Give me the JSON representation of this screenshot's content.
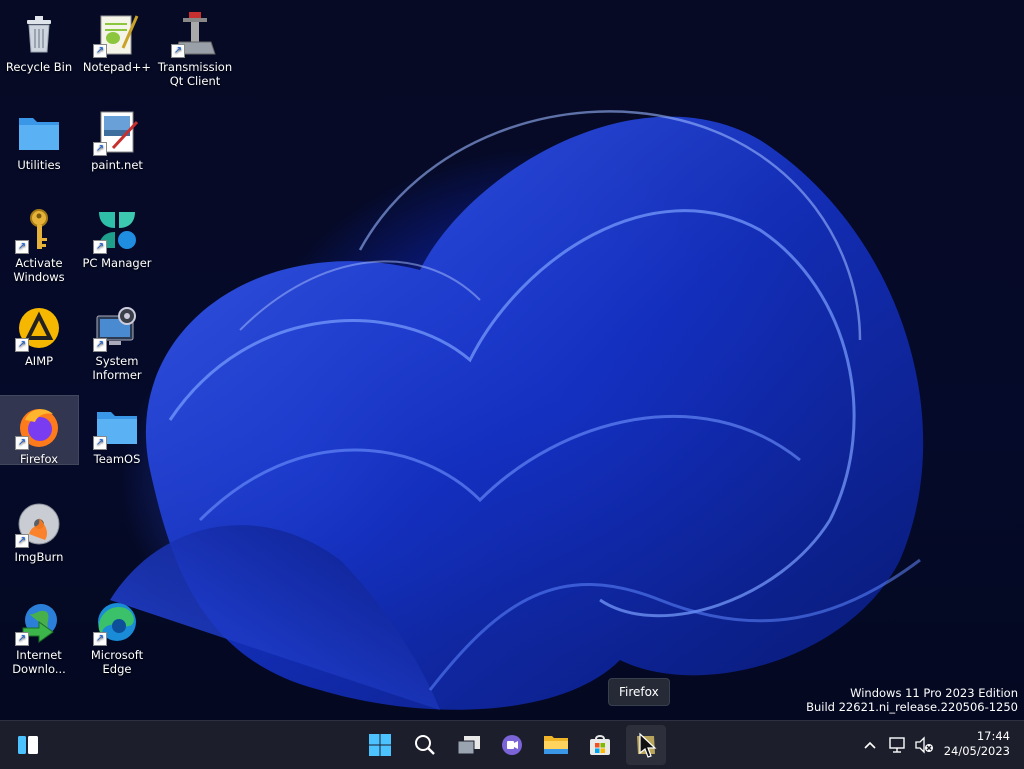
{
  "desktop": {
    "icons": [
      {
        "label": "Recycle Bin"
      },
      {
        "label": "Notepad++"
      },
      {
        "label": "Transmission Qt Client"
      },
      {
        "label": "Utilities"
      },
      {
        "label": "paint.net"
      },
      {
        "label": "Activate Windows"
      },
      {
        "label": "PC Manager"
      },
      {
        "label": "AIMP"
      },
      {
        "label": "System Informer"
      },
      {
        "label": "Firefox"
      },
      {
        "label": "TeamOS"
      },
      {
        "label": "ImgBurn"
      },
      {
        "label": "Internet Downlo..."
      },
      {
        "label": "Microsoft Edge"
      }
    ],
    "tooltip": "Firefox",
    "watermark": {
      "line1": "Windows 11 Pro 2023 Edition",
      "line2": "Build 22621.ni_release.220506-1250"
    }
  },
  "taskbar": {
    "clock": {
      "time": "17:44",
      "date": "24/05/2023"
    }
  },
  "colors": {
    "accent": "#1a6fe0",
    "taskbar": "#1c1f2b",
    "wallpaper_blue": "#1a3bd8"
  }
}
